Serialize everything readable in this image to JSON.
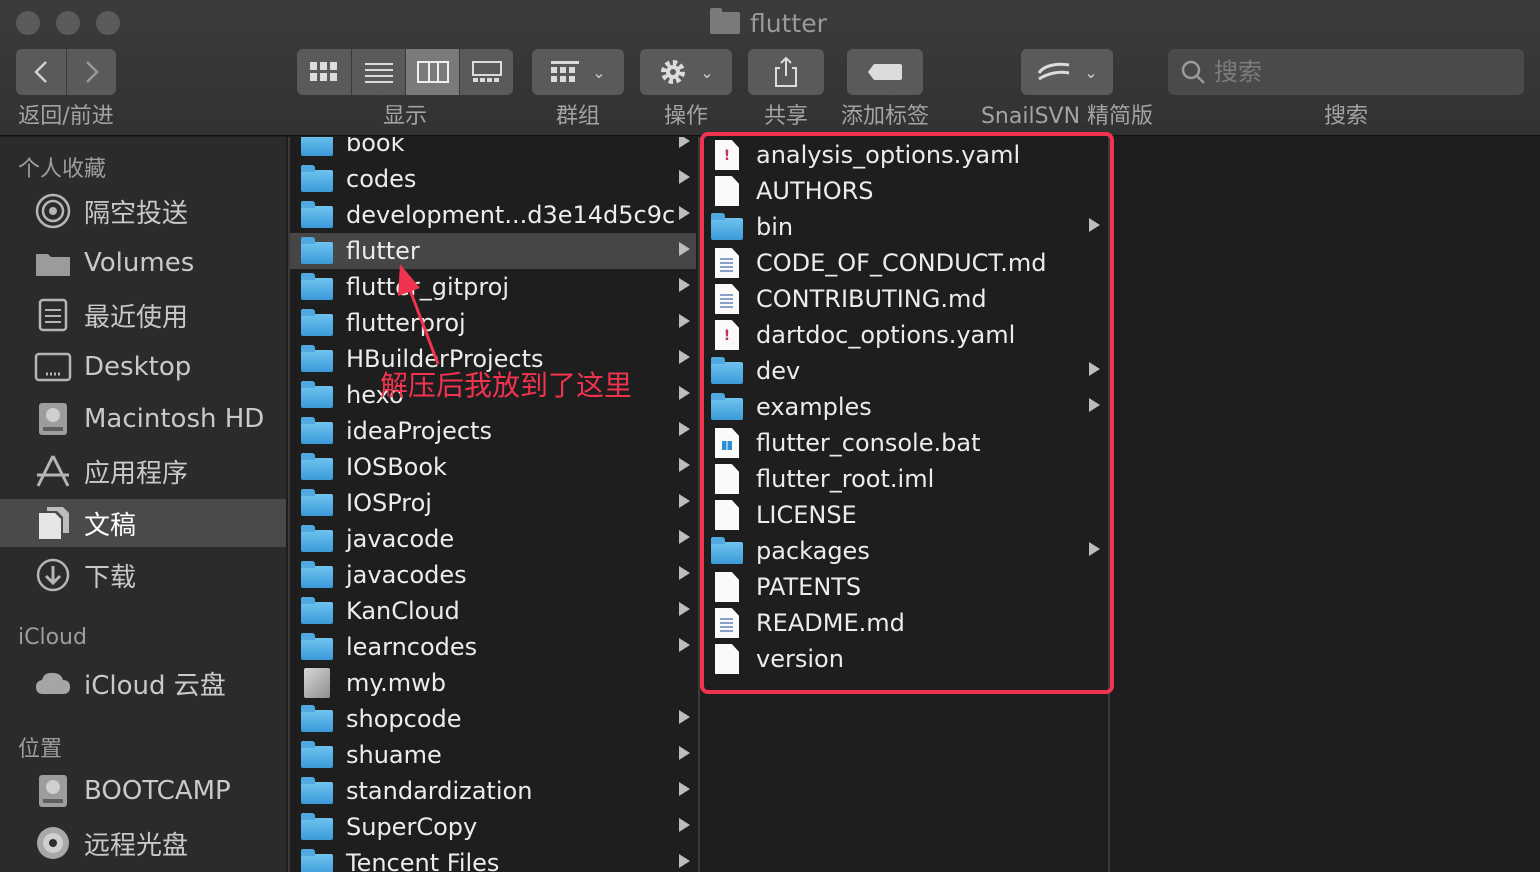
{
  "window": {
    "title": "flutter"
  },
  "toolbar": {
    "back_forward_label": "返回/前进",
    "view_label": "显示",
    "group_label": "群组",
    "action_label": "操作",
    "share_label": "共享",
    "tag_label": "添加标签",
    "snailsvn_label": "SnailSVN 精简版",
    "search_label": "搜索",
    "search_placeholder": "搜索",
    "view_mode_selected": "columns"
  },
  "sidebar": {
    "sections": [
      {
        "title": "个人收藏"
      },
      {
        "title": "iCloud"
      },
      {
        "title": "位置"
      }
    ],
    "favorites": [
      {
        "label": "隔空投送",
        "icon": "airdrop-icon"
      },
      {
        "label": "Volumes",
        "icon": "folder-icon"
      },
      {
        "label": "最近使用",
        "icon": "recents-icon"
      },
      {
        "label": "Desktop",
        "icon": "desktop-icon"
      },
      {
        "label": "Macintosh HD",
        "icon": "hard-disk-icon"
      },
      {
        "label": "应用程序",
        "icon": "applications-icon"
      },
      {
        "label": "文稿",
        "icon": "documents-icon",
        "selected": true
      },
      {
        "label": "下载",
        "icon": "downloads-icon"
      }
    ],
    "icloud": [
      {
        "label": "iCloud 云盘",
        "icon": "cloud-icon"
      }
    ],
    "locations": [
      {
        "label": "BOOTCAMP",
        "icon": "hard-disk-icon"
      },
      {
        "label": "远程光盘",
        "icon": "optical-disc-icon"
      }
    ]
  },
  "column1": {
    "items": [
      {
        "name": "book",
        "type": "folder"
      },
      {
        "name": "codes",
        "type": "folder"
      },
      {
        "name": "development...d3e14d5c9c",
        "type": "folder"
      },
      {
        "name": "flutter",
        "type": "folder",
        "selected": true
      },
      {
        "name": "flutter_gitproj",
        "type": "folder"
      },
      {
        "name": "flutterproj",
        "type": "folder"
      },
      {
        "name": "HBuilderProjects",
        "type": "folder"
      },
      {
        "name": "hexo",
        "type": "folder"
      },
      {
        "name": "ideaProjects",
        "type": "folder"
      },
      {
        "name": "IOSBook",
        "type": "folder"
      },
      {
        "name": "IOSProj",
        "type": "folder"
      },
      {
        "name": "javacode",
        "type": "folder"
      },
      {
        "name": "javacodes",
        "type": "folder"
      },
      {
        "name": "KanCloud",
        "type": "folder"
      },
      {
        "name": "learncodes",
        "type": "folder"
      },
      {
        "name": "my.mwb",
        "type": "mwb"
      },
      {
        "name": "shopcode",
        "type": "folder"
      },
      {
        "name": "shuame",
        "type": "folder"
      },
      {
        "name": "standardization",
        "type": "folder"
      },
      {
        "name": "SuperCopy",
        "type": "folder"
      },
      {
        "name": "Tencent Files",
        "type": "folder"
      }
    ]
  },
  "column2": {
    "items": [
      {
        "name": "analysis_options.yaml",
        "type": "yaml"
      },
      {
        "name": "AUTHORS",
        "type": "file"
      },
      {
        "name": "bin",
        "type": "folder"
      },
      {
        "name": "CODE_OF_CONDUCT.md",
        "type": "text"
      },
      {
        "name": "CONTRIBUTING.md",
        "type": "text"
      },
      {
        "name": "dartdoc_options.yaml",
        "type": "yaml"
      },
      {
        "name": "dev",
        "type": "folder"
      },
      {
        "name": "examples",
        "type": "folder"
      },
      {
        "name": "flutter_console.bat",
        "type": "bat"
      },
      {
        "name": "flutter_root.iml",
        "type": "file"
      },
      {
        "name": "LICENSE",
        "type": "file"
      },
      {
        "name": "packages",
        "type": "folder"
      },
      {
        "name": "PATENTS",
        "type": "file"
      },
      {
        "name": "README.md",
        "type": "text"
      },
      {
        "name": "version",
        "type": "file"
      }
    ]
  },
  "annotation": {
    "text": "解压后我放到了这里",
    "color": "#f0334f"
  },
  "colors": {
    "selection": "#464646",
    "folder": "#4fa9e0",
    "annotation": "#f0334f"
  }
}
